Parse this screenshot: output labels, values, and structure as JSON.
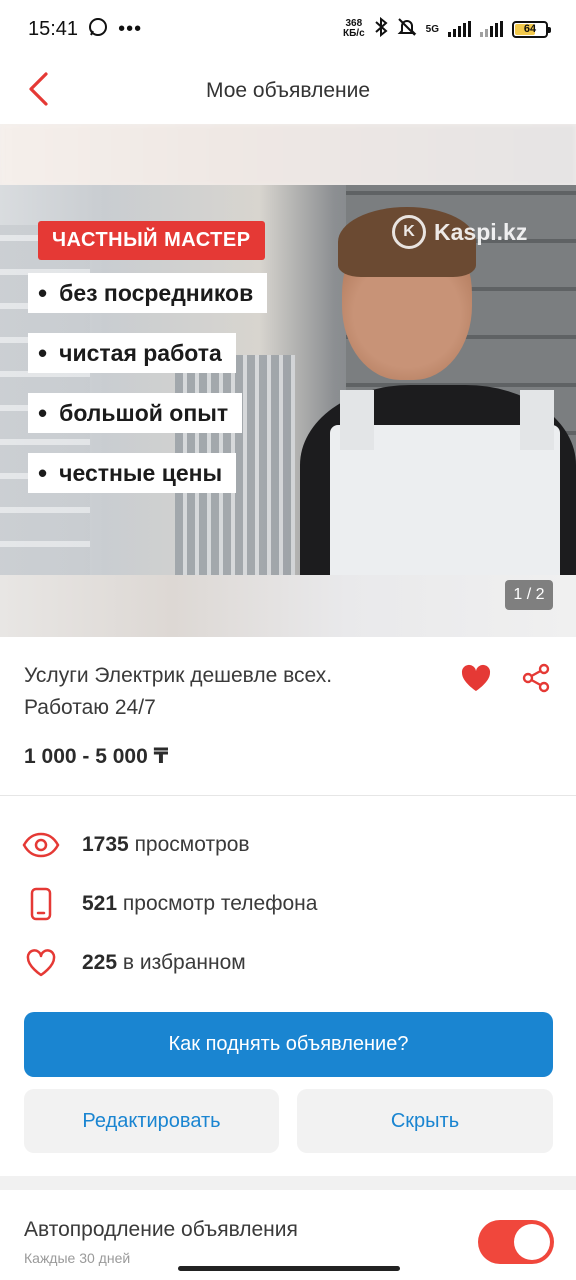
{
  "status_bar": {
    "time": "15:41",
    "speed_value": "368",
    "speed_unit": "КБ/с",
    "network": "5G",
    "battery": "64",
    "battery_level": 0.64
  },
  "header": {
    "title": "Мое объявление",
    "back_icon": "chevron-left-icon"
  },
  "gallery": {
    "badge": "ЧАСТНЫЙ МАСТЕР",
    "bullets": [
      "без посредников",
      "чистая работа",
      "большой опыт",
      "честные цены"
    ],
    "watermark": "Kaspi.kz",
    "pager": "1 / 2"
  },
  "ad": {
    "title_line1": "Услуги Электрик дешевле всех.",
    "title_line2": "Работаю 24/7",
    "price": "1 000 - 5 000 ₸"
  },
  "stats": {
    "views_count": "1735",
    "views_label": "просмотров",
    "phone_count": "521",
    "phone_label": "просмотр телефона",
    "fav_count": "225",
    "fav_label": "в избранном"
  },
  "actions": {
    "promote": "Как поднять объявление?",
    "edit": "Редактировать",
    "hide": "Скрыть"
  },
  "autorenew": {
    "title": "Автопродление объявления",
    "subtitle": "Каждые 30 дней",
    "enabled": true
  },
  "colors": {
    "accent": "#E53935",
    "primary": "#1A85D1"
  }
}
